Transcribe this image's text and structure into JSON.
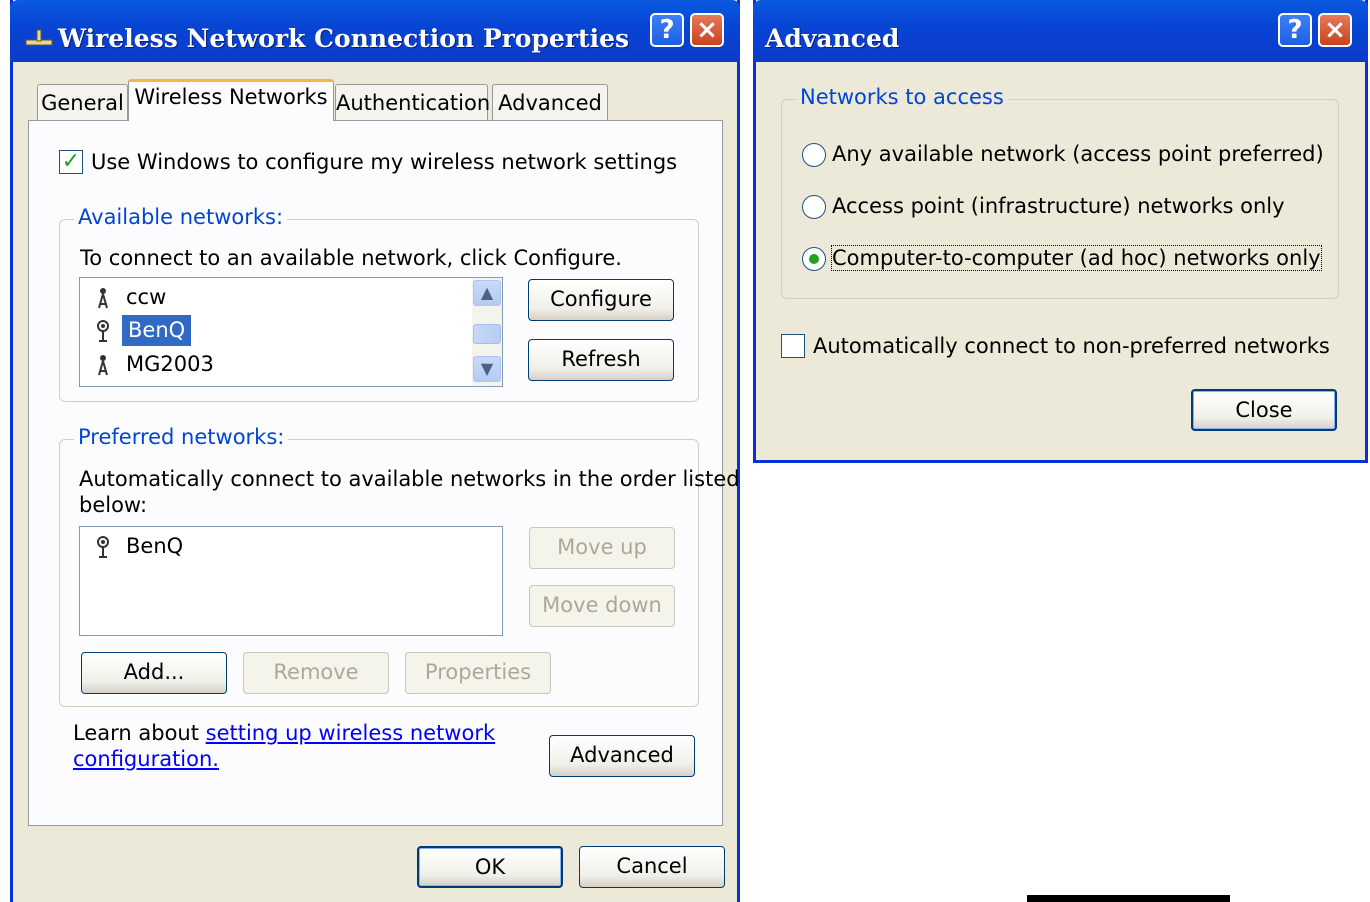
{
  "props_window": {
    "title": "Wireless Network Connection Properties",
    "help_icon": "?",
    "close_icon": "×",
    "tabs": [
      {
        "label": "General"
      },
      {
        "label": "Wireless Networks"
      },
      {
        "label": "Authentication"
      },
      {
        "label": "Advanced"
      }
    ],
    "use_windows_checkbox": {
      "label": "Use Windows to configure my wireless network settings",
      "checked": true
    },
    "available": {
      "legend": "Available networks:",
      "instruction": "To connect to an available network, click Configure.",
      "networks": [
        {
          "name": "ccw",
          "icon": "antenna-icon"
        },
        {
          "name": "BenQ",
          "icon": "preferred-network-icon",
          "selected": true
        },
        {
          "name": "MG2003",
          "icon": "antenna-icon"
        }
      ],
      "configure_label": "Configure",
      "refresh_label": "Refresh"
    },
    "preferred": {
      "legend": "Preferred networks:",
      "instruction_line1": "Automatically connect to available networks in the order listed",
      "instruction_line2": "below:",
      "networks": [
        {
          "name": "BenQ",
          "icon": "preferred-network-icon"
        }
      ],
      "move_up_label": "Move up",
      "move_down_label": "Move down",
      "add_label": "Add...",
      "remove_label": "Remove",
      "properties_label": "Properties"
    },
    "learn_prefix": "Learn about ",
    "learn_link_line1": "setting up wireless network",
    "learn_link_line2": "configuration.",
    "advanced_label": "Advanced",
    "ok_label": "OK",
    "cancel_label": "Cancel"
  },
  "advanced_window": {
    "title": "Advanced",
    "help_icon": "?",
    "close_icon": "×",
    "group_legend": "Networks to access",
    "options": [
      {
        "label": "Any available network (access point preferred)",
        "selected": false
      },
      {
        "label": "Access point (infrastructure) networks only",
        "selected": false
      },
      {
        "label": "Computer-to-computer (ad hoc) networks only",
        "selected": true
      }
    ],
    "auto_connect_label": "Automatically connect to non-preferred networks",
    "auto_connect_checked": false,
    "close_label": "Close"
  }
}
